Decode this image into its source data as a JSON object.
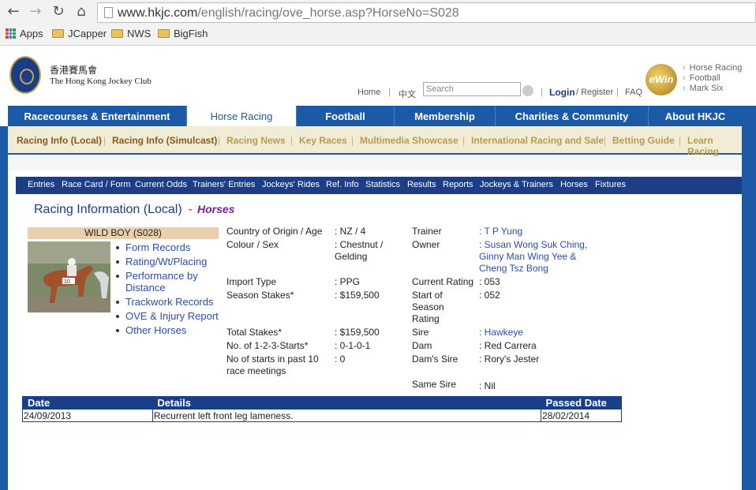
{
  "browser": {
    "url_host": "www.hkjc.com",
    "url_path": "/english/racing/ove_horse.asp?HorseNo=S028",
    "bookmarks": [
      "Apps",
      "JCapper",
      "NWS",
      "BigFish"
    ]
  },
  "header": {
    "logo_cn": "香港賽馬會",
    "logo_en": "The Hong Kong Jockey Club",
    "links": {
      "home": "Home",
      "chinese": "中文",
      "login": "Login",
      "register": "/ Register",
      "faq": "FAQ"
    },
    "search_placeholder": "Search",
    "ewin": "eWin",
    "right_links": [
      "Horse Racing",
      "Football",
      "Mark Six"
    ]
  },
  "mainnav": [
    "Racecourses & Entertainment",
    "Horse Racing",
    "Football",
    "Membership",
    "Charities & Community",
    "About HKJC"
  ],
  "subnav": [
    "Racing Info (Local)",
    "Racing Info (Simulcast)",
    "Racing News",
    "Key Races",
    "Multimedia Showcase",
    "International Racing and Sale",
    "Betting Guide",
    "Learn Racing"
  ],
  "racingnav": [
    "Entries",
    "Race Card / Form",
    "Current Odds",
    "Trainers' Entries",
    "Jockeys' Rides",
    "Ref. Info",
    "Statistics",
    "Results",
    "Reports",
    "Jockeys & Trainers",
    "Horses",
    "Fixtures"
  ],
  "title": {
    "main": "Racing Information (Local)",
    "dash": "-",
    "sub": "Horses"
  },
  "horse": {
    "name": "WILD BOY  (S028)",
    "links": [
      "Form Records",
      "Rating/Wt/Placing",
      "Performance by Distance",
      "Trackwork Records",
      "OVE & Injury Report",
      "Other Horses"
    ]
  },
  "left_fields": [
    {
      "label": "Country of Origin / Age",
      "value": ": NZ / 4"
    },
    {
      "label": "Colour / Sex",
      "value": ": Chestnut / Gelding"
    },
    {
      "label": "Import Type",
      "value": ": PPG"
    },
    {
      "label": "Season Stakes*",
      "value": ": $159,500"
    },
    {
      "label": "Total Stakes*",
      "value": ": $159,500"
    },
    {
      "label": "No. of 1-2-3-Starts*",
      "value": ": 0-1-0-1"
    },
    {
      "label": "No of starts in past 10 race meetings",
      "value": ": 0"
    }
  ],
  "right_fields": [
    {
      "label": "Trainer",
      "value": ": T P Yung"
    },
    {
      "label": "Owner",
      "value": ": Susan Wong Suk Ching, Ginny Man Wing Yee & Cheng Tsz Bong"
    },
    {
      "label": "Current Rating",
      "value": ": 053"
    },
    {
      "label": "Start of Season Rating",
      "value": ": 052"
    },
    {
      "label": "Sire",
      "value": ": Hawkeye"
    },
    {
      "label": "Dam",
      "value": ": Red Carrera"
    },
    {
      "label": "Dam's Sire",
      "value": ": Rory's Jester"
    },
    {
      "label": "Same Sire",
      "value": ": Nil"
    }
  ],
  "injury_table": {
    "headers": [
      "Date",
      "Details",
      "Passed Date"
    ],
    "rows": [
      [
        "24/09/2013",
        "Recurrent left front leg lameness.",
        "28/02/2014"
      ]
    ]
  }
}
